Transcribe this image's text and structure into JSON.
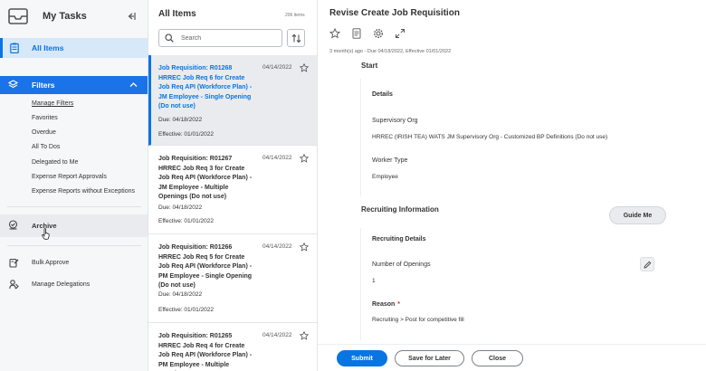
{
  "sidebar": {
    "title": "My Tasks",
    "all_items_label": "All Items",
    "filters_label": "Filters",
    "filter_items": [
      "Manage Filters",
      "Favorites",
      "Overdue",
      "All To Dos",
      "Delegated to Me",
      "Expense Report Approvals",
      "Expense Reports without Exceptions"
    ],
    "archive_label": "Archive",
    "bulk_approve_label": "Bulk Approve",
    "manage_delegations_label": "Manage Delegations"
  },
  "list": {
    "title": "All Items",
    "count": "206 items",
    "search_placeholder": "Search",
    "cards": [
      {
        "title": "Job Requisition: R01268 HRREC Job Req 6 for Create Job Req API (Workforce Plan) - JM Employee - Single Opening (Do not use)",
        "date": "04/14/2022",
        "due": "Due: 04/18/2022",
        "effective": "Effective: 01/01/2022"
      },
      {
        "title": "Job Requisition: R01267 HRREC Job Req 3 for Create Job Req API (Workforce Plan) - JM Employee - Multiple Openings (Do not use)",
        "date": "04/14/2022",
        "due": "Due: 04/18/2022",
        "effective": "Effective: 01/01/2022"
      },
      {
        "title": "Job Requisition: R01266 HRREC Job Req 5 for Create Job Req API (Workforce Plan) - PM Employee - Single Opening (Do not use)",
        "date": "04/14/2022",
        "due": "Due: 04/18/2022",
        "effective": "Effective: 01/01/2022"
      },
      {
        "title": "Job Requisition: R01265 HRREC Job Req 4 for Create Job Req API (Workforce Plan) - PM Employee - Multiple Openings",
        "date": "04/14/2022"
      }
    ]
  },
  "detail": {
    "title": "Revise Create Job Requisition",
    "meta": "3 month(s) ago - Due 04/18/2022, Effective 01/01/2022",
    "start_label": "Start",
    "details_label": "Details",
    "supervisory_org_label": "Supervisory Org",
    "supervisory_org_value": "HRREC (IRISH TEA) WATS JM Supervisory Org - Customized BP Definitions (Do not use)",
    "worker_type_label": "Worker Type",
    "worker_type_value": "Employee",
    "recruiting_info_label": "Recruiting Information",
    "guide_me_label": "Guide Me",
    "recruiting_details_label": "Recruiting Details",
    "openings_label": "Number of Openings",
    "openings_value": "1",
    "reason_label": "Reason",
    "reason_required": "*",
    "reason_value": "Recruiting > Post for competitive fill",
    "submit_label": "Submit",
    "save_later_label": "Save for Later",
    "close_label": "Close"
  },
  "colors": {
    "accent": "#0875e1",
    "filters_bg": "#1a73e8",
    "selected_bg": "#e9ebee",
    "required": "#de2e21"
  },
  "icons": [
    "inbox-icon",
    "collapse-panel-icon",
    "clipboard-icon",
    "layers-icon",
    "chevron-up-icon",
    "archive-icon",
    "cursor-hand-icon",
    "bulk-approve-icon",
    "delegation-icon",
    "search-icon",
    "sort-icon",
    "star-icon",
    "pdf-icon",
    "gear-icon",
    "expand-icon",
    "pencil-icon"
  ]
}
